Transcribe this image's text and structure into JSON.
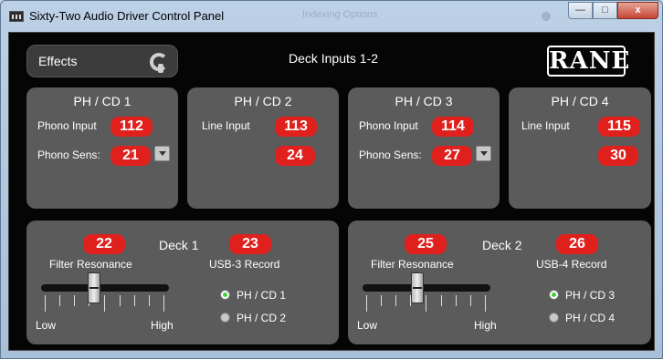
{
  "window": {
    "title": "Sixty-Two Audio Driver Control Panel",
    "ghost_tab": "Indexing Options",
    "controls": {
      "minimize": "—",
      "maximize": "□",
      "close": "x"
    }
  },
  "header": {
    "effects_label": "Effects",
    "deck_inputs_title": "Deck Inputs 1-2",
    "logo": "RANE"
  },
  "inputs": [
    {
      "title": "PH / CD 1",
      "label1": "Phono Input",
      "value1": "112",
      "label2": "Phono Sens:",
      "value2": "21",
      "has_dropdown": true
    },
    {
      "title": "PH / CD 2",
      "label1": "Line Input",
      "value1": "113",
      "label2": "",
      "value2": "24",
      "has_dropdown": false
    },
    {
      "title": "PH / CD 3",
      "label1": "Phono Input",
      "value1": "114",
      "label2": "Phono Sens:",
      "value2": "27",
      "has_dropdown": true
    },
    {
      "title": "PH / CD 4",
      "label1": "Line Input",
      "value1": "115",
      "label2": "",
      "value2": "30",
      "has_dropdown": false
    }
  ],
  "decks": [
    {
      "title": "Deck 1",
      "filter_badge": "22",
      "filter_label": "Filter Resonance",
      "record_badge": "23",
      "record_label": "USB-3 Record",
      "slider_low": "Low",
      "slider_high": "High",
      "slider_value": 0.45,
      "options": [
        {
          "label": "PH / CD 1",
          "selected": true
        },
        {
          "label": "PH / CD 2",
          "selected": false
        }
      ]
    },
    {
      "title": "Deck 2",
      "filter_badge": "25",
      "filter_label": "Filter Resonance",
      "record_badge": "26",
      "record_label": "USB-4 Record",
      "slider_low": "Low",
      "slider_high": "High",
      "slider_value": 0.45,
      "options": [
        {
          "label": "PH / CD 3",
          "selected": true
        },
        {
          "label": "PH / CD 4",
          "selected": false
        }
      ]
    }
  ],
  "colors": {
    "badge": "#e0201c",
    "panel": "#5b5b5b",
    "background": "#050505",
    "radio_on": "#3fcf3f"
  }
}
